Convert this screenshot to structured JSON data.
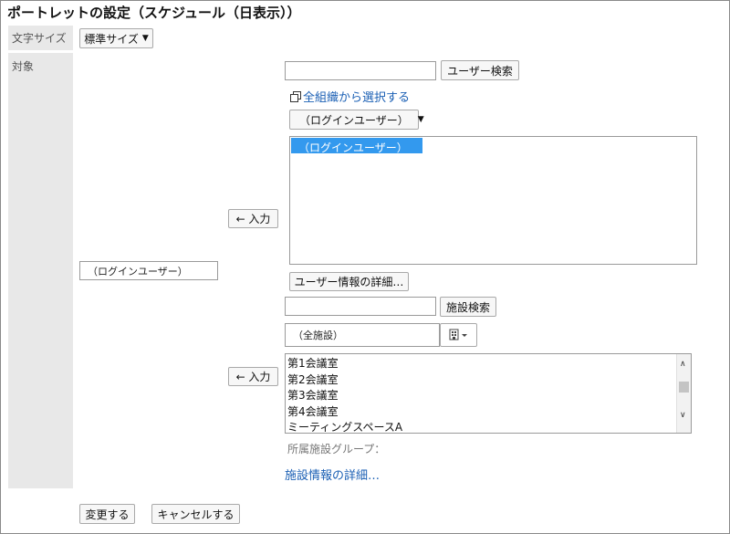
{
  "page": {
    "title": "ポートレットの設定（スケジュール（日表示））"
  },
  "rows": {
    "font_size_label": "文字サイズ",
    "target_label": "対象"
  },
  "font_size": {
    "selected": "標準サイズ"
  },
  "user_section": {
    "search_value": "",
    "search_button": "ユーザー検索",
    "org_link": "全組織から選択する",
    "group_dropdown": "（ログインユーザー）",
    "listbox_items": [
      "（ログインユーザー）"
    ],
    "add_button": "← 入力",
    "detail_button": "ユーザー情報の詳細…"
  },
  "selected_target": {
    "value": "（ログインユーザー）"
  },
  "facility_section": {
    "search_value": "",
    "search_button": "施設検索",
    "group_value": "（全施設）",
    "listbox_items": [
      "第1会議室",
      "第2会議室",
      "第3会議室",
      "第4会議室",
      "ミーティングスペースA"
    ],
    "add_button": "← 入力",
    "group_caption": "所属施設グループ：",
    "detail_link": "施設情報の詳細…"
  },
  "footer": {
    "submit_button": "変更する",
    "cancel_button": "キャンセルする"
  },
  "colors": {
    "link": "#1a5fb4",
    "selection": "#3399ee",
    "label_bg": "#e8e8e8"
  },
  "icons": [
    "chevron-down-icon",
    "popup-window-icon",
    "facility-picker-icon",
    "scroll-up-icon",
    "scroll-down-icon"
  ]
}
